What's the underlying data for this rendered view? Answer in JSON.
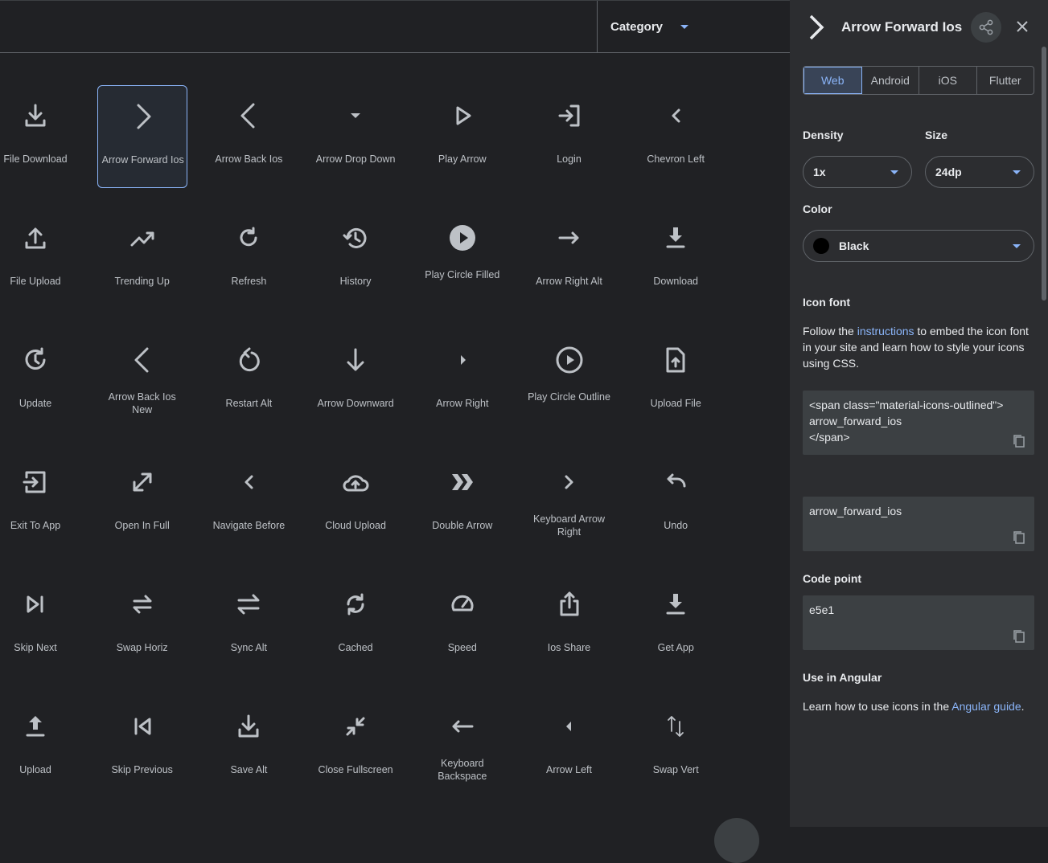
{
  "category": {
    "label": "Category"
  },
  "icons": [
    {
      "name": "File Download",
      "glyph": "file-download-icon"
    },
    {
      "name": "Arrow Forward Ios",
      "glyph": "arrow-forward-ios-icon",
      "selected": true
    },
    {
      "name": "Arrow Back Ios",
      "glyph": "arrow-back-ios-icon"
    },
    {
      "name": "Arrow Drop Down",
      "glyph": "arrow-drop-down-icon"
    },
    {
      "name": "Play Arrow",
      "glyph": "play-arrow-icon"
    },
    {
      "name": "Login",
      "glyph": "login-icon"
    },
    {
      "name": "Chevron Left",
      "glyph": "chevron-left-icon"
    },
    {
      "name": "File Upload",
      "glyph": "file-upload-icon"
    },
    {
      "name": "Trending Up",
      "glyph": "trending-up-icon"
    },
    {
      "name": "Refresh",
      "glyph": "refresh-icon"
    },
    {
      "name": "History",
      "glyph": "history-icon"
    },
    {
      "name": "Play Circle Filled",
      "glyph": "play-circle-filled-icon"
    },
    {
      "name": "Arrow Right Alt",
      "glyph": "arrow-right-alt-icon"
    },
    {
      "name": "Download",
      "glyph": "download-icon"
    },
    {
      "name": "Update",
      "glyph": "update-icon"
    },
    {
      "name": "Arrow Back Ios New",
      "glyph": "arrow-back-ios-new-icon"
    },
    {
      "name": "Restart Alt",
      "glyph": "restart-alt-icon"
    },
    {
      "name": "Arrow Downward",
      "glyph": "arrow-downward-icon"
    },
    {
      "name": "Arrow Right",
      "glyph": "arrow-right-icon"
    },
    {
      "name": "Play Circle Outline",
      "glyph": "play-circle-outline-icon"
    },
    {
      "name": "Upload File",
      "glyph": "upload-file-icon"
    },
    {
      "name": "Exit To App",
      "glyph": "exit-to-app-icon"
    },
    {
      "name": "Open In Full",
      "glyph": "open-in-full-icon"
    },
    {
      "name": "Navigate Before",
      "glyph": "navigate-before-icon"
    },
    {
      "name": "Cloud Upload",
      "glyph": "cloud-upload-icon"
    },
    {
      "name": "Double Arrow",
      "glyph": "double-arrow-icon"
    },
    {
      "name": "Keyboard Arrow Right",
      "glyph": "keyboard-arrow-right-icon"
    },
    {
      "name": "Undo",
      "glyph": "undo-icon"
    },
    {
      "name": "Skip Next",
      "glyph": "skip-next-icon"
    },
    {
      "name": "Swap Horiz",
      "glyph": "swap-horiz-icon"
    },
    {
      "name": "Sync Alt",
      "glyph": "sync-alt-icon"
    },
    {
      "name": "Cached",
      "glyph": "cached-icon"
    },
    {
      "name": "Speed",
      "glyph": "speed-icon"
    },
    {
      "name": "Ios Share",
      "glyph": "ios-share-icon"
    },
    {
      "name": "Get App",
      "glyph": "get-app-icon"
    },
    {
      "name": "Upload",
      "glyph": "upload-icon"
    },
    {
      "name": "Skip Previous",
      "glyph": "skip-previous-icon"
    },
    {
      "name": "Save Alt",
      "glyph": "save-alt-icon"
    },
    {
      "name": "Close Fullscreen",
      "glyph": "close-fullscreen-icon"
    },
    {
      "name": "Keyboard Backspace",
      "glyph": "keyboard-backspace-icon"
    },
    {
      "name": "Arrow Left",
      "glyph": "arrow-left-icon"
    },
    {
      "name": "Swap Vert",
      "glyph": "swap-vert-icon"
    }
  ],
  "panel": {
    "title": "Arrow Forward Ios",
    "tabs": [
      "Web",
      "Android",
      "iOS",
      "Flutter"
    ],
    "active_tab": "Web",
    "density_label": "Density",
    "density_value": "1x",
    "size_label": "Size",
    "size_value": "24dp",
    "color_label": "Color",
    "color_value": "Black",
    "icon_font_label": "Icon font",
    "icon_font_text_pre": "Follow the ",
    "icon_font_link": "instructions",
    "icon_font_text_post": " to embed the icon font in your site and learn how to style your icons using CSS.",
    "code_line1": "<span class=\"material-icons-outlined\">",
    "code_line2": "arrow_forward_ios",
    "code_line3": "</span>",
    "ligature": "arrow_forward_ios",
    "code_point_label": "Code point",
    "code_point": "e5e1",
    "angular_label": "Use in Angular",
    "angular_text_pre": "Learn how to use icons in the ",
    "angular_link": "Angular guide",
    "angular_text_post": "."
  },
  "colors": {
    "accent": "#8ab4f8",
    "icon": "#bdc1c6",
    "bg": "#202124",
    "panel": "#2c2d30"
  }
}
